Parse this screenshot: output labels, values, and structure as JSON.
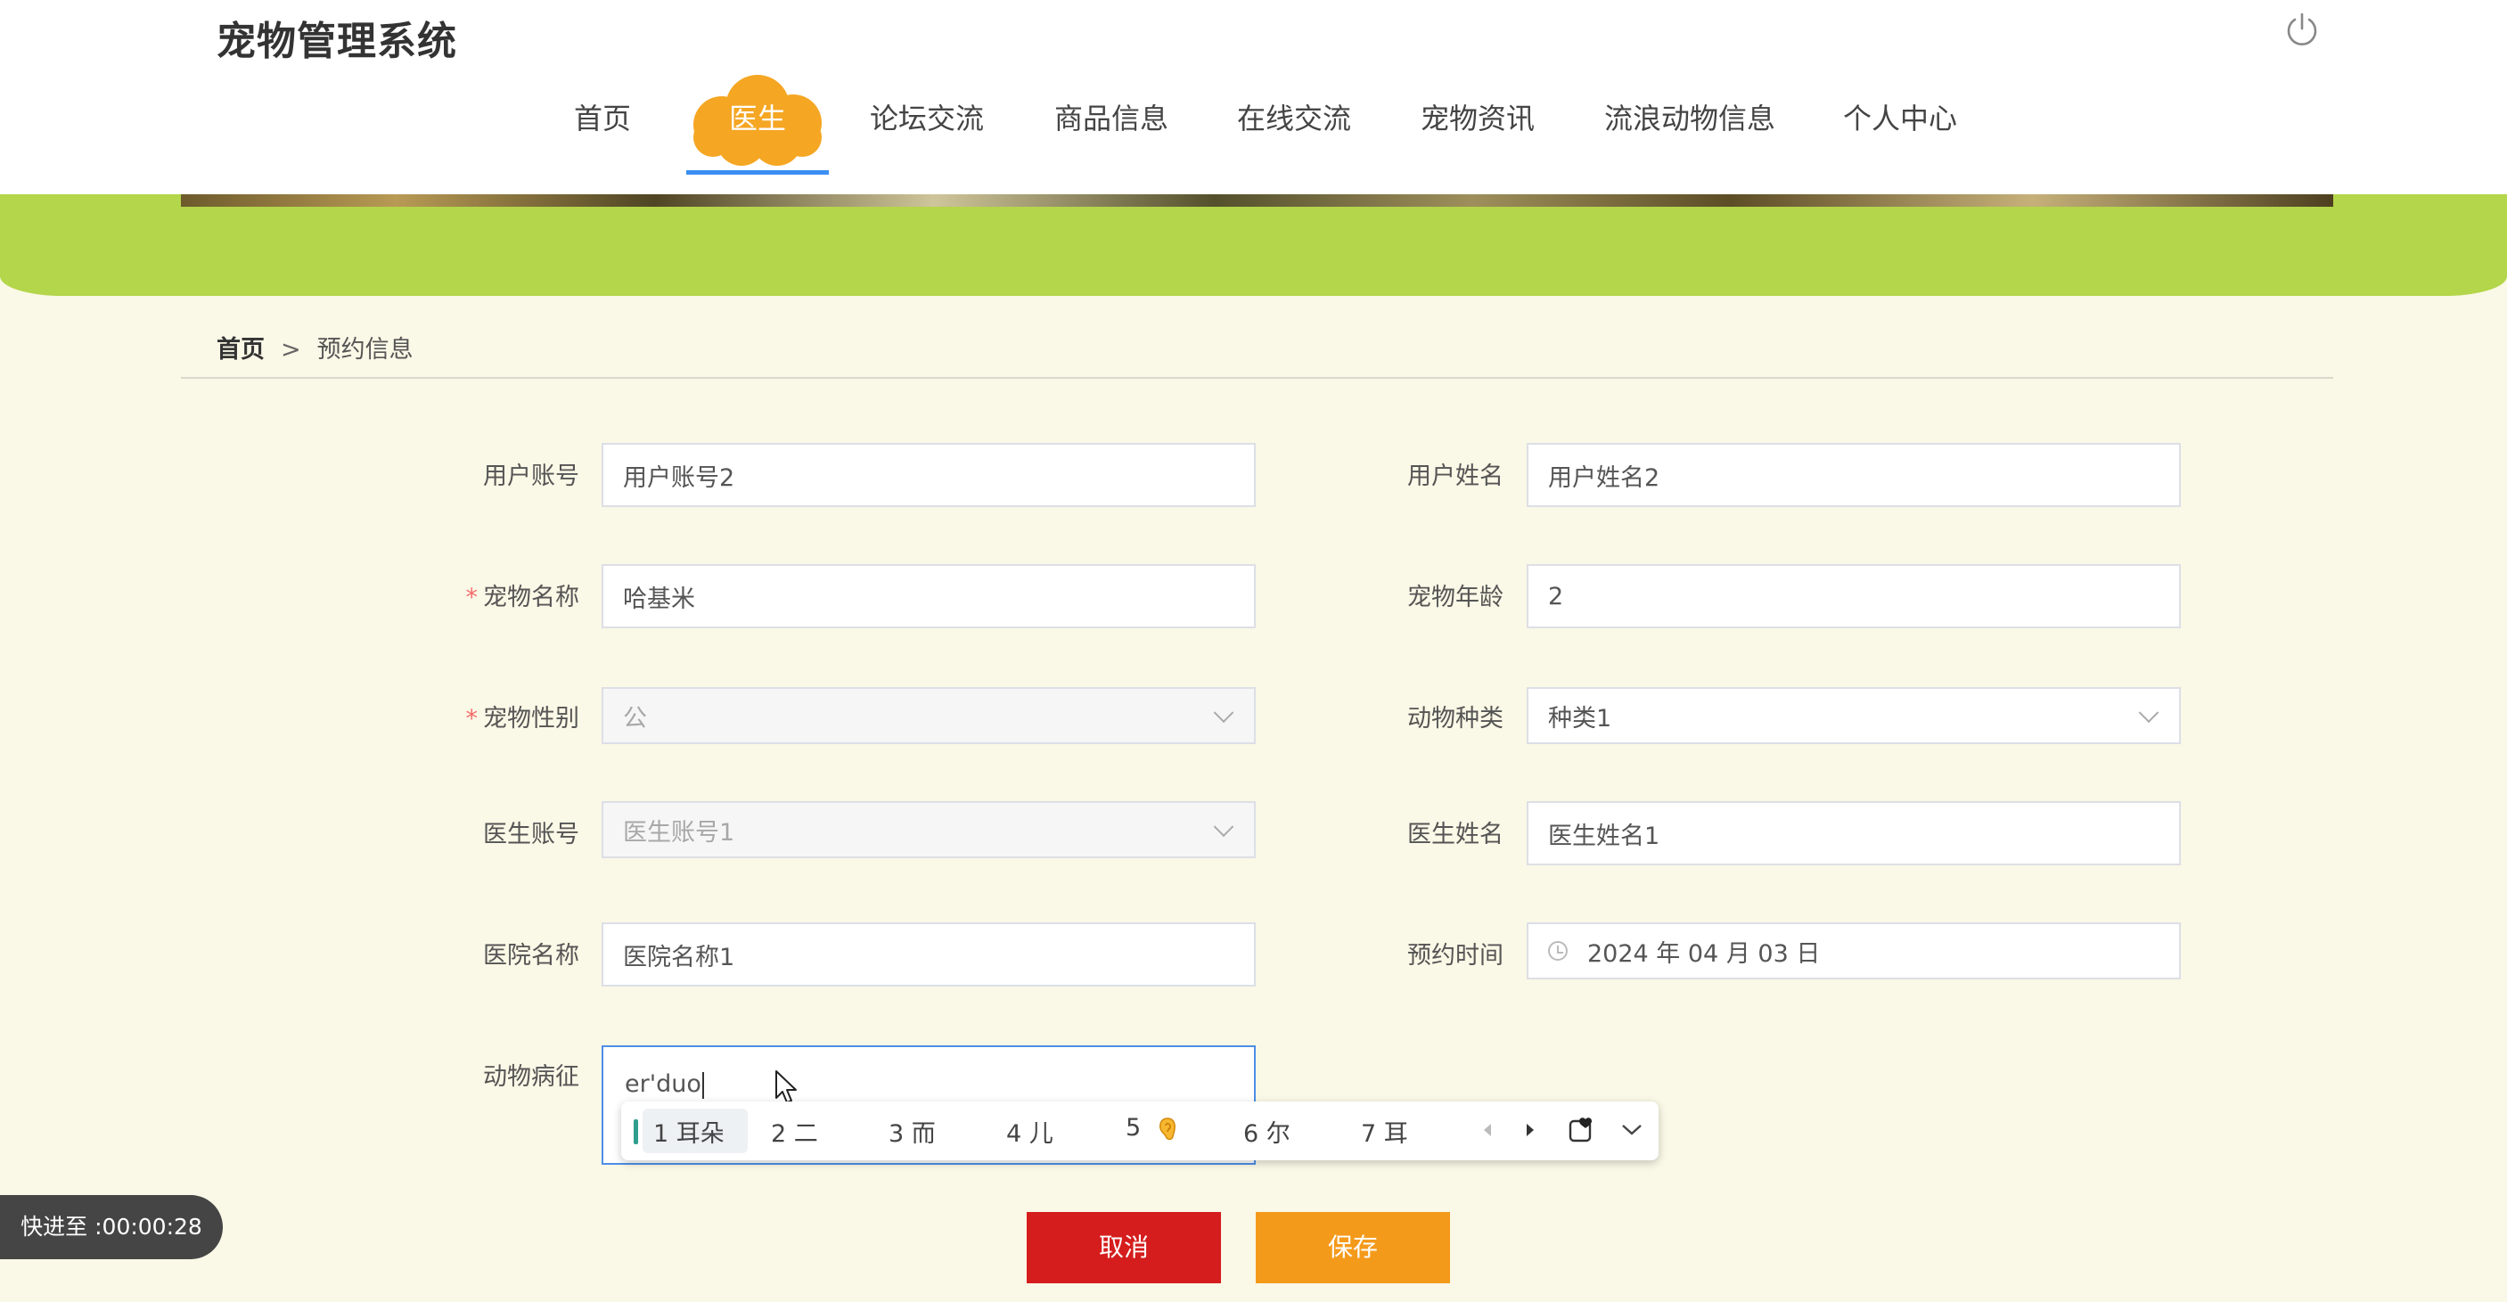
{
  "header": {
    "app_title": "宠物管理系统",
    "power_icon": "power-icon",
    "nav": [
      "首页",
      "医生",
      "论坛交流",
      "商品信息",
      "在线交流",
      "宠物资讯",
      "流浪动物信息",
      "个人中心"
    ],
    "active_nav": "医生",
    "accent_color": "#f5a623"
  },
  "breadcrumb": {
    "home": "首页",
    "separator": ">",
    "current": "预约信息"
  },
  "form": {
    "user_account": {
      "label": "用户账号",
      "value": "用户账号2"
    },
    "user_name": {
      "label": "用户姓名",
      "value": "用户姓名2"
    },
    "pet_name": {
      "label": "宠物名称",
      "value": "哈基米",
      "required": "*"
    },
    "pet_age": {
      "label": "宠物年龄",
      "value": "2"
    },
    "pet_gender": {
      "label": "宠物性别",
      "value": "公",
      "required": "*"
    },
    "animal_type": {
      "label": "动物种类",
      "value": "种类1"
    },
    "doctor_account": {
      "label": "医生账号",
      "value": "医生账号1"
    },
    "doctor_name": {
      "label": "医生姓名",
      "value": "医生姓名1"
    },
    "hospital_name": {
      "label": "医院名称",
      "value": "医院名称1"
    },
    "appointment_time": {
      "label": "预约时间",
      "value": "2024 年 04 月 03 日"
    },
    "symptom": {
      "label": "动物病征",
      "value": "er'duo"
    }
  },
  "ime": {
    "candidates": [
      "1 耳朵",
      "2 二",
      "3 而",
      "4 儿",
      "5",
      "6 尔",
      "7 耳"
    ],
    "icons": [
      "prev-page-icon",
      "next-page-icon",
      "sticker-icon",
      "expand-icon"
    ]
  },
  "buttons": {
    "cancel": "取消",
    "save": "保存"
  },
  "overlay": {
    "toast": "快进至 :00:00:28"
  }
}
